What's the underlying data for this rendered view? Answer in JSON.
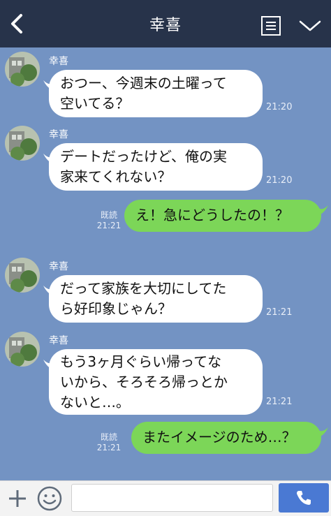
{
  "header": {
    "title": "幸喜",
    "back_icon": "back-chevron-icon",
    "menu_icon": "notes-icon",
    "expand_icon": "chevron-down-icon"
  },
  "colors": {
    "background": "#7393c3",
    "header": "#27334a",
    "incoming_bubble": "#ffffff",
    "outgoing_bubble": "#7cd658",
    "call_button": "#4a79d3"
  },
  "messages": [
    {
      "sender": "幸喜",
      "direction": "in",
      "lines": [
        "おつー、今週末の土曜って",
        "空いてる？"
      ],
      "time": "21:20"
    },
    {
      "sender": "幸喜",
      "direction": "in",
      "lines": [
        "デートだったけど、俺の実",
        "家来てくれない？"
      ],
      "time": "21:20"
    },
    {
      "direction": "out",
      "lines": [
        "え！急にどうしたの！？"
      ],
      "time": "21:21",
      "read_label": "既読"
    },
    {
      "sender": "幸喜",
      "direction": "in",
      "lines": [
        "だって家族を大切にしてた",
        "ら好印象じゃん？"
      ],
      "time": "21:21"
    },
    {
      "sender": "幸喜",
      "direction": "in",
      "lines": [
        "もう3ヶ月ぐらい帰ってな",
        "いから、そろそろ帰っとか",
        "ないと…。"
      ],
      "time": "21:21"
    },
    {
      "direction": "out",
      "lines": [
        "またイメージのため…？"
      ],
      "time": "21:21",
      "read_label": "既読"
    }
  ],
  "footer": {
    "plus_icon": "plus-icon",
    "emoji_icon": "smiley-icon",
    "input_value": "",
    "call_icon": "phone-icon"
  }
}
